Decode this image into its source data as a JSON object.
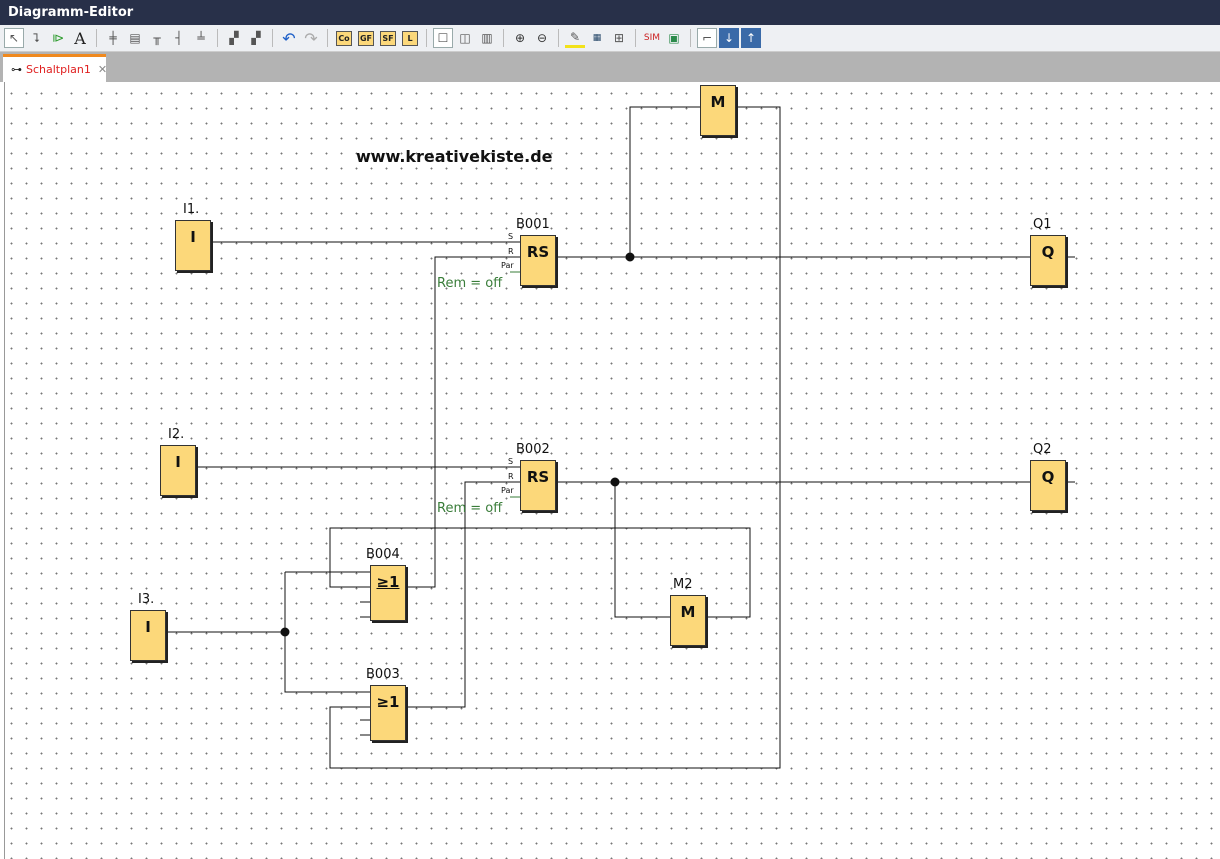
{
  "window": {
    "title": "Diagramm-Editor"
  },
  "toolbar": {
    "tools": [
      "select-icon",
      "connect-icon",
      "connector-icon",
      "text-icon"
    ],
    "align": [
      "align-left-icon",
      "align-right-icon",
      "align-top-icon",
      "align-hcenter-icon",
      "align-vcenter-icon"
    ],
    "function_blocks": [
      "Co",
      "GF",
      "SF",
      "L"
    ]
  },
  "tabs": [
    {
      "label": "Schaltplan1",
      "active": true
    }
  ],
  "canvas": {
    "watermark": "www.kreativekiste.de",
    "inputs": [
      {
        "label": "I1.",
        "text": "I"
      },
      {
        "label": "I2.",
        "text": "I"
      },
      {
        "label": "I3.",
        "text": "I"
      }
    ],
    "rs_blocks": [
      {
        "label": "B001",
        "text": "RS",
        "pins": [
          "S",
          "R",
          "Par"
        ],
        "param": "Rem = off"
      },
      {
        "label": "B002",
        "text": "RS",
        "pins": [
          "S",
          "R",
          "Par"
        ],
        "param": "Rem = off"
      }
    ],
    "or_blocks": [
      {
        "label": "B004",
        "text": "≥1"
      },
      {
        "label": "B003",
        "text": "≥1"
      }
    ],
    "outputs": [
      {
        "label": "Q1",
        "text": "Q"
      },
      {
        "label": "Q2",
        "text": "Q"
      }
    ],
    "markers": [
      {
        "label": "",
        "text": "M"
      },
      {
        "label": "M2",
        "text": "M"
      }
    ]
  }
}
